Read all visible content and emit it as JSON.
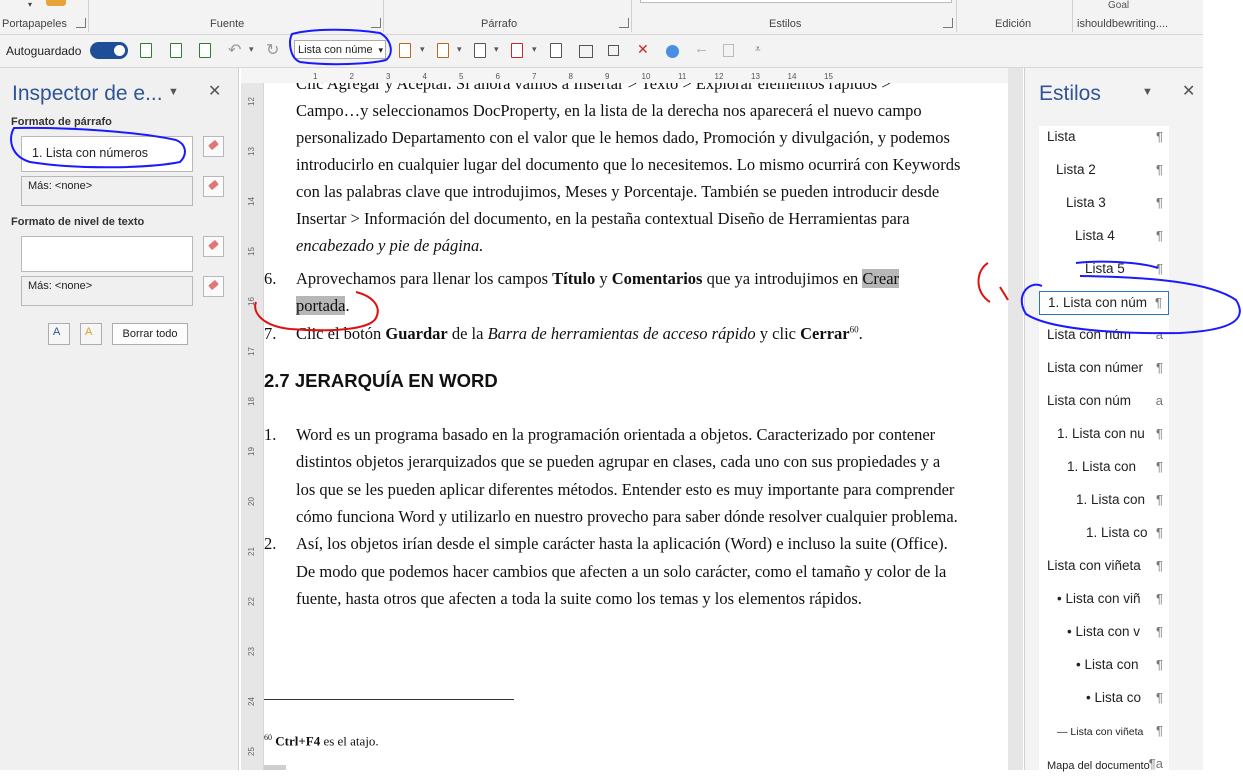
{
  "ribbon": {
    "groups": [
      "Portapapeles",
      "Fuente",
      "Párrafo",
      "Estilos",
      "Edición",
      "ishouldbewriting...."
    ],
    "goal_label": "Goal"
  },
  "qat": {
    "autosave_label": "Autoguardado",
    "style_box_value": "Lista con núme"
  },
  "inspector": {
    "title": "Inspector de e...",
    "paragraph_format_label": "Formato de párrafo",
    "paragraph_style_value": "1.  Lista con números",
    "paragraph_more_value": "Más: <none>",
    "text_level_label": "Formato de nivel de texto",
    "text_level_value": "",
    "text_more_value": "Más: <none>",
    "clear_all_label": "Borrar todo"
  },
  "ruler": {
    "ticks": [
      "1",
      "2",
      "3",
      "4",
      "5",
      "6",
      "7",
      "8",
      "9",
      "10",
      "11",
      "12",
      "13",
      "14",
      "15"
    ]
  },
  "document": {
    "lines": [
      {
        "t": "Clic Agregar y Aceptar. Si ahora vamos a Insertar > Texto > Explorar elementos rápidos >"
      },
      {
        "t": "Campo…y seleccionamos DocProperty, en la lista de la derecha nos aparecerá el nuevo campo"
      },
      {
        "t": "personalizado Departamento con el valor que le hemos dado, Promoción y divulgación, y podemos"
      },
      {
        "t": "introducirlo en cualquier lugar del documento que lo necesitemos. Lo mismo ocurrirá con Keywords"
      },
      {
        "t": "con las palabras clave que introdujimos, Meses y Porcentaje. También se pueden introducir desde"
      },
      {
        "t": "Insertar > Información del documento, en la pestaña contextual Diseño de Herramientas para"
      },
      {
        "t": "encabezado y pie de página."
      }
    ],
    "item6_num": "6.",
    "item6_line1_a": "Aprovechamos para llenar los campos ",
    "item6_b1": "Título",
    "item6_mid": " y ",
    "item6_b2": "Comentarios",
    "item6_line1_c": " que ya introdujimos en ",
    "item6_hl1": "Crear",
    "item6_hl2": "portada",
    "item6_end": ".",
    "item7_num": "7.",
    "item7_a": "Clic el botón ",
    "item7_b1": "Guardar",
    "item7_c": " de la ",
    "item7_i": "Barra de herramientas de acceso rápido",
    "item7_d": " y clic ",
    "item7_b2": "Cerrar",
    "item7_sup": "60",
    "item7_e": ".",
    "heading": "2.7   JERARQUÍA EN WORD",
    "list2": [
      {
        "num": "1.",
        "lines": [
          "Word es un programa basado en la programación orientada a objetos. Caracterizado por contener",
          "distintos objetos jerarquizados que se pueden agrupar en clases, cada uno con sus propiedades y a",
          "los que se les pueden aplicar diferentes métodos. Entender esto es muy importante para comprender",
          "cómo funciona Word y utilizarlo en nuestro provecho para saber dónde resolver cualquier problema."
        ]
      },
      {
        "num": "2.",
        "lines": [
          "Así, los objetos irían desde el simple carácter hasta la aplicación (Word) e incluso la suite (Office).",
          "De modo que podemos hacer cambios que afecten a un solo carácter, como el tamaño y color de la",
          "fuente, hasta otros que afecten a toda la suite como los temas y los elementos rápidos."
        ]
      }
    ],
    "footnote_sup": "60",
    "footnote_bold": "Ctrl+F4",
    "footnote_text": " es el atajo."
  },
  "styles_pane": {
    "title": "Estilos",
    "items": [
      {
        "label": "Lista",
        "mark": "¶",
        "indent": 8
      },
      {
        "label": "Lista 2",
        "mark": "¶",
        "indent": 17
      },
      {
        "label": "Lista 3",
        "mark": "¶",
        "indent": 27
      },
      {
        "label": "Lista 4",
        "mark": "¶",
        "indent": 36
      },
      {
        "label": "Lista 5",
        "mark": "¶",
        "indent": 46
      },
      {
        "label": "1.  Lista con núm",
        "mark": "¶",
        "indent": 8,
        "selected": true
      },
      {
        "label": "Lista con núm",
        "mark": "a",
        "indent": 8
      },
      {
        "label": "Lista con númer",
        "mark": "¶",
        "indent": 8
      },
      {
        "label": "Lista con núm",
        "mark": "a",
        "indent": 8
      },
      {
        "label": "1.  Lista con nu",
        "mark": "¶",
        "indent": 18
      },
      {
        "label": "1.  Lista con",
        "mark": "¶",
        "indent": 28
      },
      {
        "label": "1.  Lista con",
        "mark": "¶",
        "indent": 37
      },
      {
        "label": "1.  Lista co",
        "mark": "¶",
        "indent": 47
      },
      {
        "label": "Lista con viñeta",
        "mark": "¶",
        "indent": 8
      },
      {
        "label": "•  Lista con viñ",
        "mark": "¶",
        "indent": 18
      },
      {
        "label": "•  Lista con v",
        "mark": "¶",
        "indent": 28
      },
      {
        "label": "•  Lista con",
        "mark": "¶",
        "indent": 37
      },
      {
        "label": "•  Lista co",
        "mark": "¶",
        "indent": 47
      },
      {
        "label": "—  Lista con viñeta",
        "mark": "¶",
        "indent": 18
      },
      {
        "label": "Mapa del documento",
        "mark": "¶a",
        "indent": 8
      }
    ]
  },
  "colors": {
    "accent": "#2f5597",
    "annotation_blue": "#1a1aff",
    "annotation_red": "#e01010"
  }
}
